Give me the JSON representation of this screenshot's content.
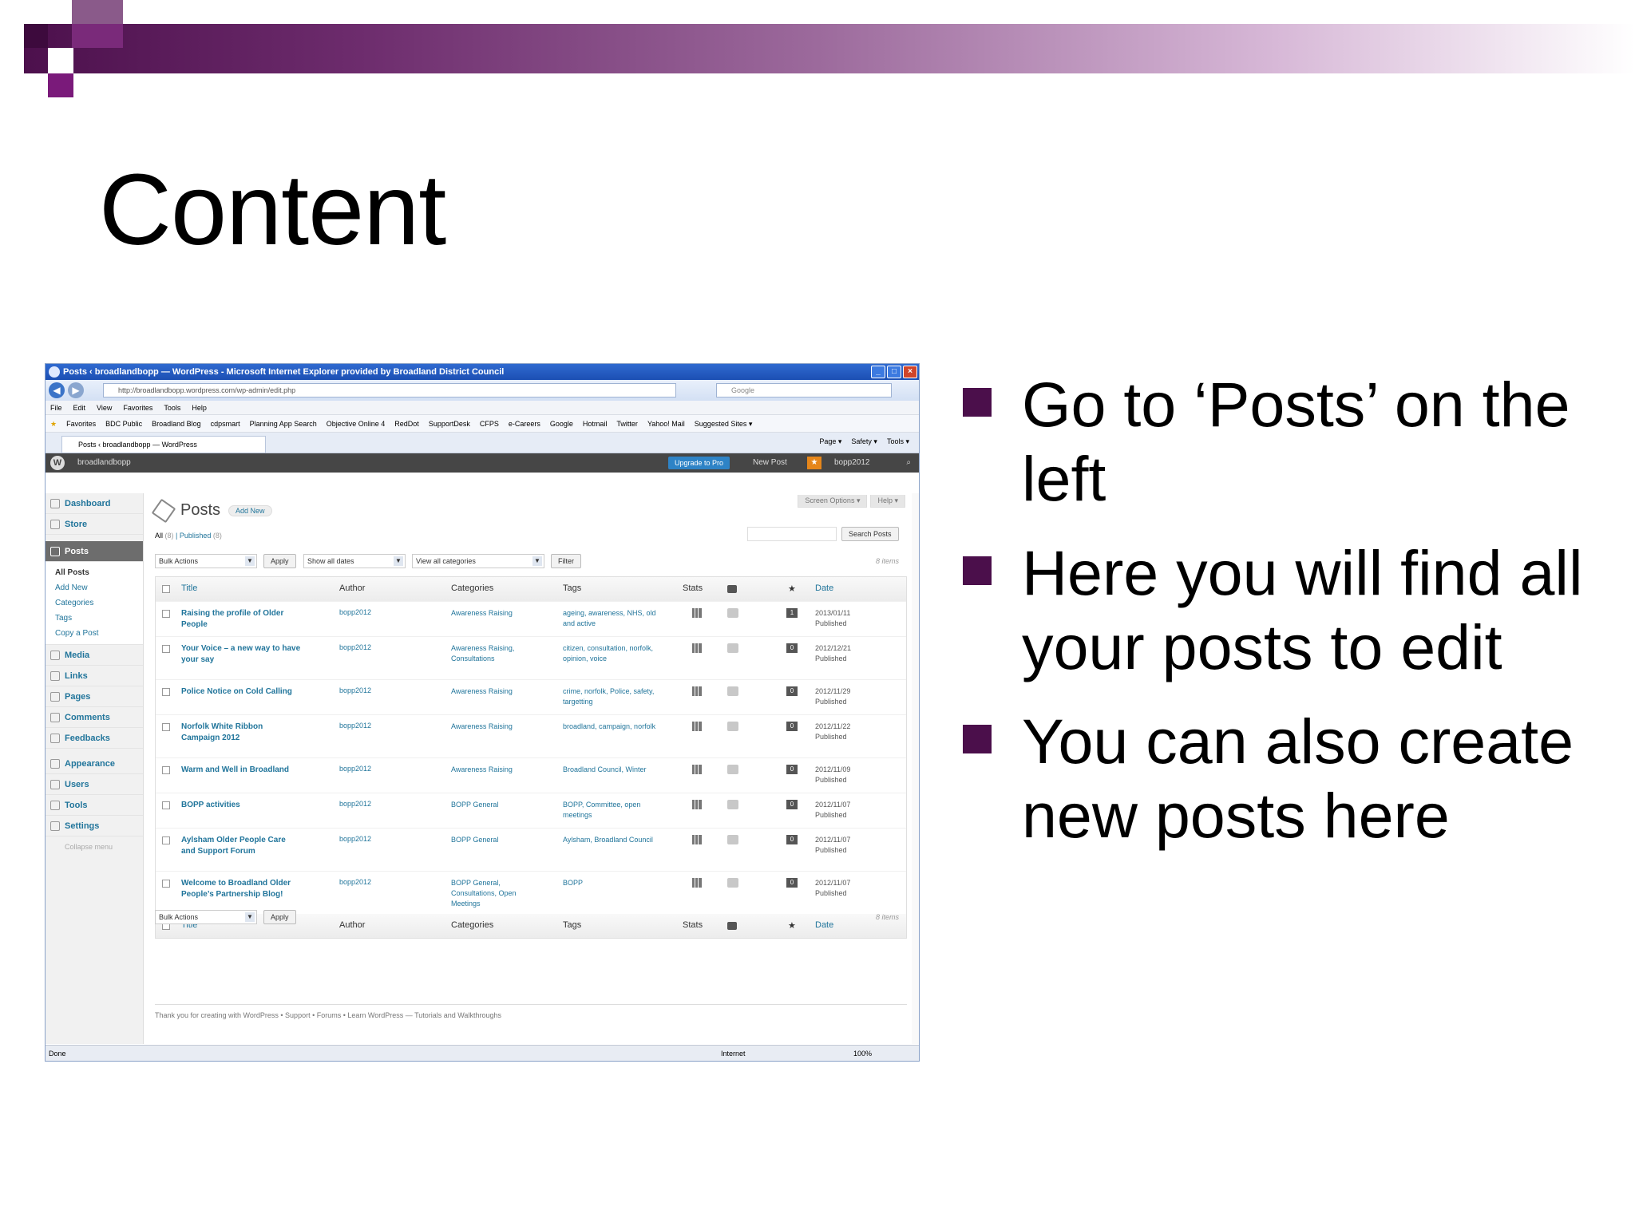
{
  "slide": {
    "title": "Content",
    "bullets": [
      "Go to ‘Posts’ on the left",
      "Here you will find all your posts to edit",
      "You can also create new posts here"
    ]
  },
  "browser": {
    "window_title": "Posts ‹ broadlandbopp — WordPress - Microsoft Internet Explorer provided by Broadland District Council",
    "address": "http://broadlandbopp.wordpress.com/wp-admin/edit.php",
    "search_placeholder": "Google",
    "menu": [
      "File",
      "Edit",
      "View",
      "Favorites",
      "Tools",
      "Help"
    ],
    "favorites": [
      "Favorites",
      "BDC Public",
      "Broadland Blog",
      "cdpsmart",
      "Planning App Search",
      "Objective Online 4",
      "RedDot",
      "SupportDesk",
      "CFPS",
      "e-Careers",
      "Google",
      "Hotmail",
      "Twitter",
      "Yahoo! Mail",
      "Suggested Sites ▾"
    ],
    "tab_title": "Posts ‹ broadlandbopp — WordPress",
    "commands": [
      "Page ▾",
      "Safety ▾",
      "Tools ▾"
    ],
    "status_left": "Done",
    "status_zone": "Internet",
    "zoom": "100%"
  },
  "adminbar": {
    "site": "broadlandbopp",
    "upgrade": "Upgrade to Pro",
    "new_post": "New Post",
    "user": "bopp2012"
  },
  "sidebar": {
    "items_top": [
      "Dashboard",
      "Store"
    ],
    "active": "Posts",
    "submenu": [
      "All Posts",
      "Add New",
      "Categories",
      "Tags",
      "Copy a Post"
    ],
    "items_mid": [
      "Media",
      "Links",
      "Pages",
      "Comments",
      "Feedbacks"
    ],
    "items_bottom": [
      "Appearance",
      "Users",
      "Tools",
      "Settings"
    ],
    "collapse": "Collapse menu"
  },
  "posts_page": {
    "screen_options": "Screen Options ▾",
    "help": "Help ▾",
    "heading": "Posts",
    "add_new": "Add New",
    "filter_all": "All",
    "filter_all_count": "(8)",
    "filter_published": "Published",
    "filter_published_count": "(8)",
    "search_button": "Search Posts",
    "bulk_actions": "Bulk Actions",
    "apply": "Apply",
    "dates": "Show all dates",
    "categories": "View all categories",
    "filter": "Filter",
    "items_top": "8 items",
    "items_bottom": "8 items",
    "columns": {
      "title": "Title",
      "author": "Author",
      "categories": "Categories",
      "tags": "Tags",
      "stats": "Stats",
      "date": "Date"
    },
    "rows": [
      {
        "title": "Raising the profile of Older People",
        "author": "bopp2012",
        "categories": "Awareness Raising",
        "tags": "ageing, awareness, NHS, old and active",
        "comments": "1",
        "date": "2013/01/11",
        "status": "Published"
      },
      {
        "title": "Your Voice – a new way to have your say",
        "author": "bopp2012",
        "categories": "Awareness Raising, Consultations",
        "tags": "citizen, consultation, norfolk, opinion, voice",
        "comments": "0",
        "date": "2012/12/21",
        "status": "Published"
      },
      {
        "title": "Police Notice on Cold Calling",
        "author": "bopp2012",
        "categories": "Awareness Raising",
        "tags": "crime, norfolk, Police, safety, targetting",
        "comments": "0",
        "date": "2012/11/29",
        "status": "Published"
      },
      {
        "title": "Norfolk White Ribbon Campaign 2012",
        "author": "bopp2012",
        "categories": "Awareness Raising",
        "tags": "broadland, campaign, norfolk",
        "comments": "0",
        "date": "2012/11/22",
        "status": "Published"
      },
      {
        "title": "Warm and Well in Broadland",
        "author": "bopp2012",
        "categories": "Awareness Raising",
        "tags": "Broadland Council, Winter",
        "comments": "0",
        "date": "2012/11/09",
        "status": "Published"
      },
      {
        "title": "BOPP activities",
        "author": "bopp2012",
        "categories": "BOPP General",
        "tags": "BOPP, Committee, open meetings",
        "comments": "0",
        "date": "2012/11/07",
        "status": "Published"
      },
      {
        "title": "Aylsham Older People Care and Support Forum",
        "author": "bopp2012",
        "categories": "BOPP General",
        "tags": "Aylsham, Broadland Council",
        "comments": "0",
        "date": "2012/11/07",
        "status": "Published"
      },
      {
        "title": "Welcome to Broadland Older People’s Partnership Blog!",
        "author": "bopp2012",
        "categories": "BOPP General, Consultations, Open Meetings",
        "tags": "BOPP",
        "comments": "0",
        "date": "2012/11/07",
        "status": "Published"
      }
    ],
    "footer": "Thank you for creating with WordPress • Support • Forums • Learn WordPress — Tutorials and Walkthroughs"
  }
}
